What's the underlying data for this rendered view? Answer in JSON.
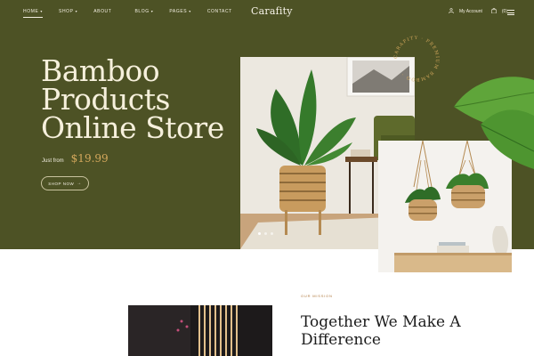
{
  "nav": {
    "items": [
      {
        "label": "Home",
        "caret": true,
        "active": true
      },
      {
        "label": "Shop",
        "caret": true
      },
      {
        "label": "About",
        "caret": false
      },
      {
        "label": "Blog",
        "caret": true
      },
      {
        "label": "Pages",
        "caret": true
      },
      {
        "label": "Contact",
        "caret": false
      }
    ],
    "logo": "Carafity",
    "account_label": "My Account",
    "cart_count": "(0)",
    "icons": {
      "account": "user-icon",
      "cart": "bag-icon",
      "menu": "hamburger-icon"
    }
  },
  "hero": {
    "title_lines": [
      "Bamboo",
      "Products",
      "Online Store"
    ],
    "price_label": "Just from",
    "price_value": "$19.99",
    "button_label": "SHOP NOW",
    "badge_text": "CARAFITY · PREMIUM BAMBOO · ",
    "slides": 3,
    "active_slide": 1
  },
  "mission": {
    "eyebrow": "OUR MISSION",
    "title": "Together We Make A Difference"
  },
  "colors": {
    "hero_bg": "#4d5225",
    "accent": "#d4a85c",
    "text_light": "#f6f0dc",
    "heading_dark": "#1c1c1c"
  }
}
